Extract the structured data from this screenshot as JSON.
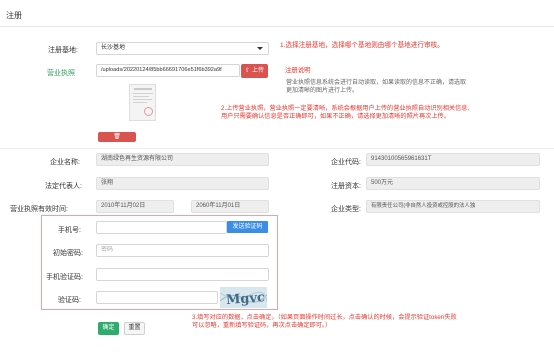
{
  "page_title": "注册",
  "form": {
    "base_label": "注册基地:",
    "base_value": "长沙基地",
    "license_label": "营业执照",
    "license_path": "/uploads/20220124/85bb66691706e51f6b392a9f",
    "upload_label": "上传",
    "upload_icon": "upload-icon",
    "delete_icon": "trash-icon",
    "company_name_label": "企业名称:",
    "company_name_value": "湖南绿色再生资源有限公司",
    "company_code_label": "企业代码:",
    "company_code_value": "91430100565961631T",
    "legal_rep_label": "法定代表人:",
    "legal_rep_value": "张翔",
    "reg_capital_label": "注册资本:",
    "reg_capital_value": "500万元",
    "valid_period_label": "营业执照有效时间:",
    "valid_from": "2010年11月02日",
    "valid_to": "2060年11月01日",
    "company_type_label": "企业类型:",
    "company_type_value": "有限责任公司(非自然人投资或控股的法人独",
    "phone_label": "手机号:",
    "phone_value": "",
    "send_code_label": "发送验证码",
    "password_label": "初始密码:",
    "password_placeholder": "密码",
    "sms_code_label": "手机验证码:",
    "sms_code_value": "",
    "captcha_label": "验证码:",
    "captcha_value": "",
    "captcha_text": "Mgvc",
    "submit_label": "确定",
    "reset_label": "重置"
  },
  "notes": {
    "note1": "1.选择注册基地，选择哪个基地则由哪个基地进行审核。",
    "hint_title": "注册说明",
    "hint_line1": "营业执照信息系统会进行自动读取，如果读取的信息不正确，请选取",
    "hint_line2": "更加清晰的图片进行上传。",
    "note2_line1": "2.上传营业执照，营业执照一定要清晰，系统会根据用户上传的营业执照自动识别相关信息,",
    "note2_line2": "用户只需要确认信息是否正确即可，如果不正确，请选择更加清晰的照片再次上传。",
    "note3_line1": "3.填写对应的数据，点击确定，（如果页面操作时间过长，点击确认的时候，会提示验证token失败",
    "note3_line2": "可以忽略，重新填写验证码，再次点击确定即可。）"
  },
  "colors": {
    "accent_red": "#e8382f",
    "button_red": "#d9534f",
    "button_blue": "#3a8ee6",
    "button_green": "#2eac6d",
    "label_green": "#2e9e5a"
  }
}
